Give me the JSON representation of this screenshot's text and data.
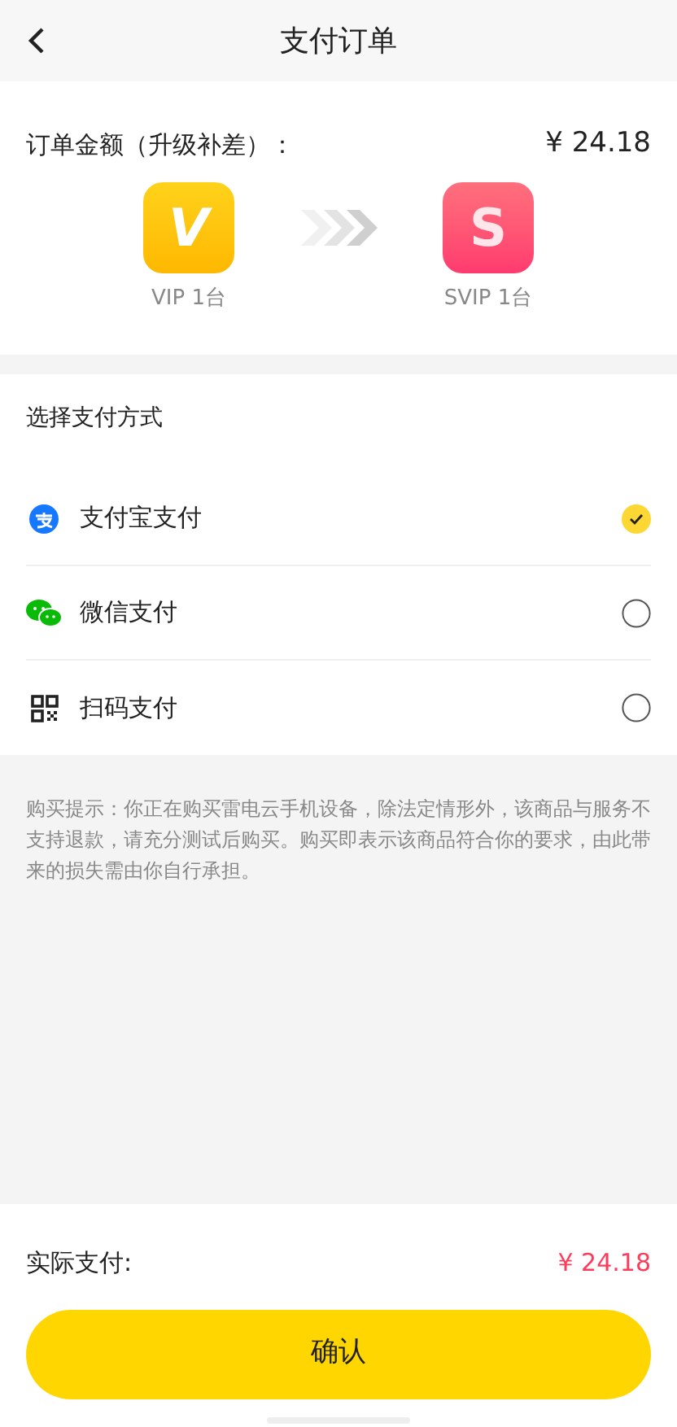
{
  "header": {
    "title": "支付订单"
  },
  "order": {
    "label": "订单金额（升级补差）：",
    "amount": "¥ 24.18",
    "from": {
      "letter": "V",
      "caption": "VIP 1台"
    },
    "to": {
      "letter": "S",
      "caption": "SVIP 1台"
    }
  },
  "payment": {
    "title": "选择支付方式",
    "methods": [
      {
        "kind": "alipay",
        "label": "支付宝支付",
        "selected": true
      },
      {
        "kind": "wechat",
        "label": "微信支付",
        "selected": false
      },
      {
        "kind": "qrcode",
        "label": "扫码支付",
        "selected": false
      }
    ]
  },
  "notice": "购买提示：你正在购买雷电云手机设备，除法定情形外，该商品与服务不支持退款，请充分测试后购买。购买即表示该商品符合你的要求，由此带来的损失需由你自行承担。",
  "footer": {
    "label": "实际支付:",
    "amount": "¥ 24.18",
    "button": "确认"
  }
}
